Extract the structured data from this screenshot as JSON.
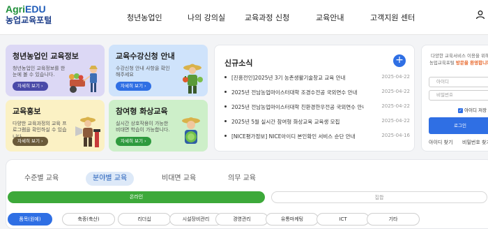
{
  "logo": {
    "brand_a": "Agri",
    "brand_b": "EDU",
    "name": "농업교육포털"
  },
  "nav": [
    "청년농업인",
    "나의 강의실",
    "교육과정 신청",
    "교육안내",
    "고객지원 센터"
  ],
  "cards": [
    {
      "title": "청년농업인 교육정보",
      "desc": "청년농업인 교육정보를 한 눈에 볼 수 있습니다.",
      "button": "자세히 보기 ›"
    },
    {
      "title": "교육수강신청 안내",
      "desc": "수강신청 안내 사항을 확인해주세요",
      "button": "자세히 보기 ›"
    },
    {
      "title": "교육홍보",
      "desc": "다양한 교육과정의 교육 프로그램을 확인하실 수 있습니다.",
      "button": "자세히 보기 ›"
    },
    {
      "title": "참여형 화상교육",
      "desc": "실시간 상호작용이 가능한 비대면 학습이 가능합니다.",
      "button": "자세히 보기 ›"
    }
  ],
  "news": {
    "title": "신규소식",
    "plus": "+",
    "items": [
      {
        "text": "[진흥전인]2025년 3기 농촌생활기술창교 교육 안내",
        "date": "2025-04-22"
      },
      {
        "text": "2025년 전남농업마이스터대학 조경수전공 국외연수 안내",
        "date": "2025-04-22"
      },
      {
        "text": "2025년 전남농업마이스터대학 친환경한우전공 국외연수 안내",
        "date": "2025-04-22"
      },
      {
        "text": "2025년 5월 실시간 참여형 화상교육 교육생 모집",
        "date": "2025-04-22"
      },
      {
        "text": "[NICE평가정보] NICE아이디 본인확인 서비스 순단 안내",
        "date": "2025-04-16"
      }
    ]
  },
  "login": {
    "guide_1": "다양한 교육서비스 이용을 위해",
    "guide_2": "농업교육포털",
    "guide_highlight": "방문을 환영합니다",
    "id_placeholder": "아이디",
    "pw_placeholder": "비밀번호",
    "save_id": "아이디 저장",
    "button": "로그인",
    "find_id": "아이디 찾기",
    "find_pw": "비밀번호 찾기"
  },
  "edu": {
    "tabs": [
      "수준별 교육",
      "분야별 교육",
      "비대면 교육",
      "의무 교육"
    ],
    "active_tab": 1,
    "modes": [
      "온라인",
      "집합"
    ],
    "chips": [
      "품목(원예)",
      "축종(축산)",
      "리더십",
      "시설장비관리",
      "경영관리",
      "유통마케팅",
      "ICT",
      "기타"
    ]
  },
  "colors": {
    "brand_green": "#1f8f3a",
    "brand_blue": "#1e5bb8",
    "primary": "#2f6fe4",
    "online_bar": "#3da93a",
    "card_purple": "#dcd8f5",
    "card_blue": "#cfe3fb",
    "card_yellow": "#fbf1c4",
    "card_green": "#cdefc9"
  }
}
